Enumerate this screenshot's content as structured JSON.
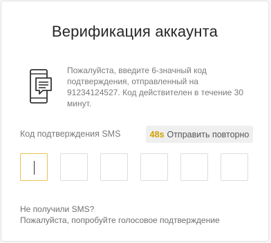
{
  "page": {
    "title": "Верификация аккаунта"
  },
  "info": {
    "icon": "phone-message-icon",
    "text": "Пожалуйста, введите 6-значный код подтверждения, отправленный на 91234124527. Код действителен в течение 30 минут."
  },
  "code": {
    "label": "Код подтверждения SMS",
    "length": 6,
    "values": [
      "",
      "",
      "",
      "",
      "",
      ""
    ],
    "active_index": 0
  },
  "resend": {
    "timer": "48s",
    "label": "Отправить повторно"
  },
  "help": {
    "line1": "Не получили SMS?",
    "line2": "Пожалуйста, попробуйте голосовое подтверждение"
  },
  "colors": {
    "accent": "#e8c24e",
    "timer": "#d1a100"
  }
}
